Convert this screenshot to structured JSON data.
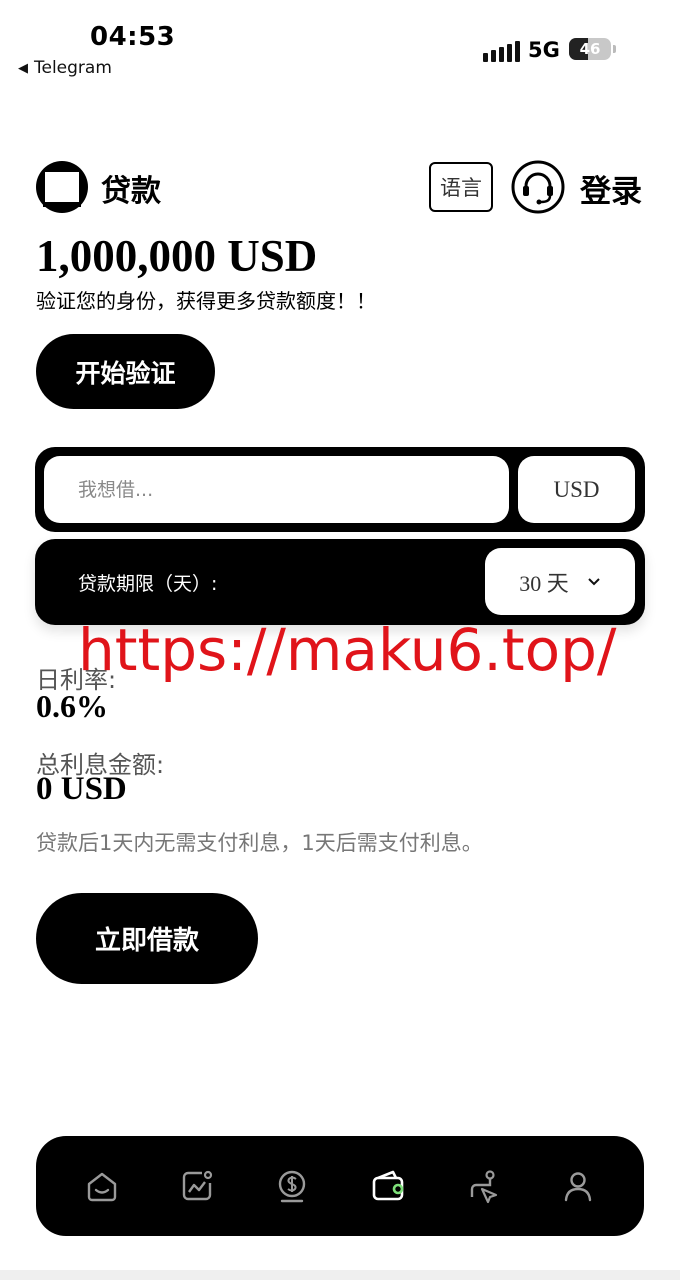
{
  "status_bar": {
    "time": "04:53",
    "back_app": "Telegram",
    "network": "5G",
    "battery": "46",
    "battery_level": 0.46
  },
  "header": {
    "title": "贷款",
    "language_label": "语言",
    "login_label": "登录"
  },
  "hero": {
    "amount": "1,000,000 USD",
    "subtitle": "验证您的身份，获得更多贷款额度！！",
    "verify_button": "开始验证"
  },
  "loan_form": {
    "amount_placeholder": "我想借...",
    "amount_value": "",
    "currency": "USD",
    "term_label": "贷款期限（天）:",
    "term_selected": "30 天"
  },
  "overlay_url": "https://maku6.top/",
  "rates": {
    "daily_rate_label": "日利率:",
    "daily_rate_value": "0.6%",
    "total_interest_label": "总利息金额:",
    "total_interest_value": "0 USD",
    "note": "贷款后1天内无需支付利息，1天后需支付利息。"
  },
  "borrow_button": "立即借款",
  "bottom_nav": {
    "items": [
      "home-icon",
      "chart-icon",
      "coin-icon",
      "wallet-icon",
      "route-icon",
      "user-icon"
    ],
    "active": "wallet-icon",
    "active_dot_color": "#7ee07a"
  }
}
